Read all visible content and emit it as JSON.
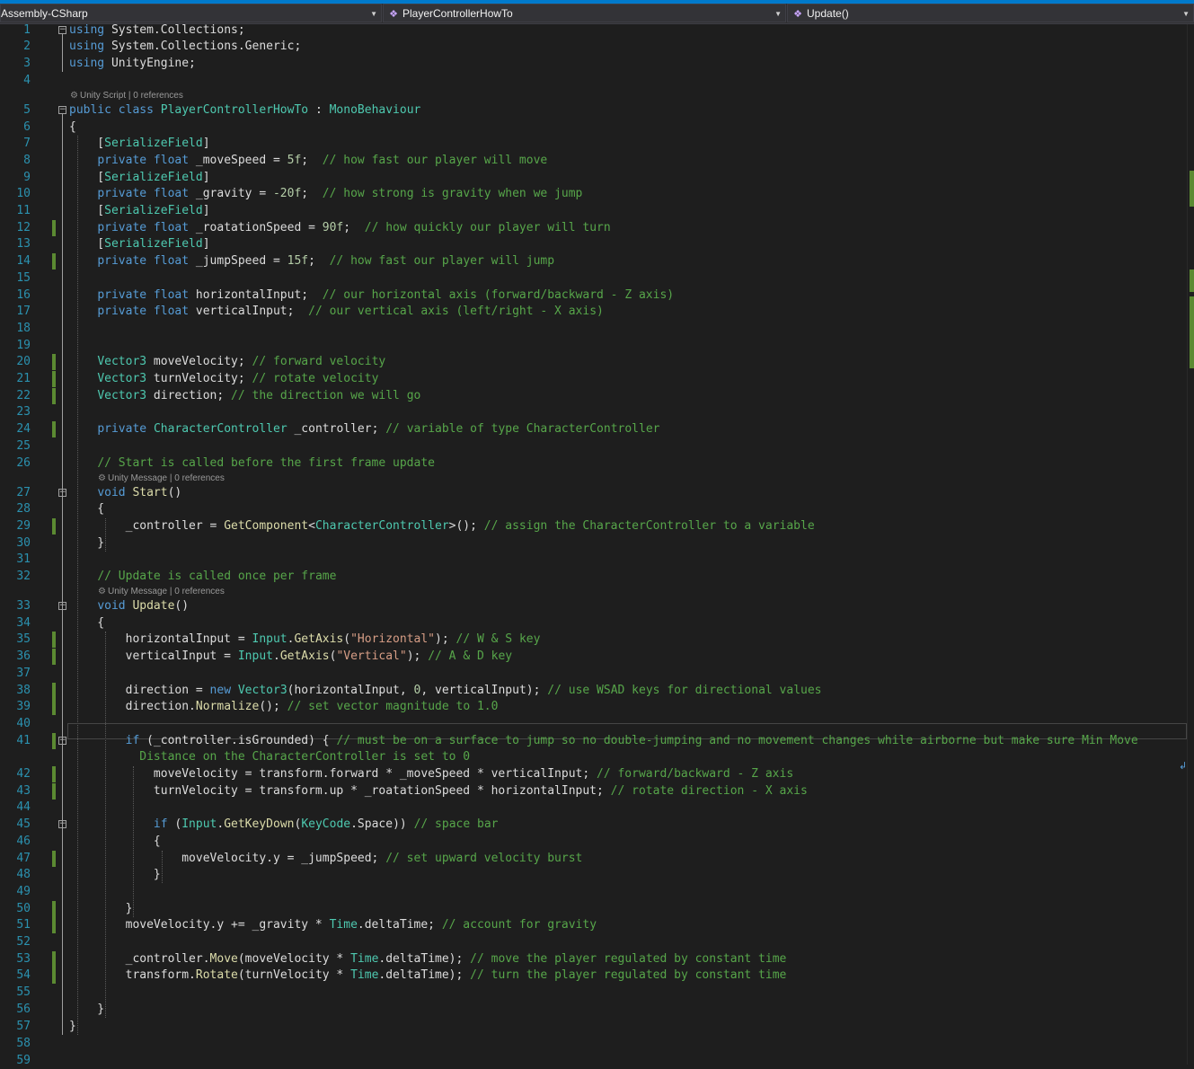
{
  "navbar": {
    "project": "Assembly-CSharp",
    "type": "PlayerControllerHowTo",
    "member": "Update()"
  },
  "codelens": {
    "unity_script": "Unity Script | 0 references",
    "unity_message": "Unity Message | 0 references"
  },
  "line_numbers": [
    "1",
    "2",
    "3",
    "4",
    "5",
    "6",
    "7",
    "8",
    "9",
    "10",
    "11",
    "12",
    "13",
    "14",
    "15",
    "16",
    "17",
    "18",
    "19",
    "20",
    "21",
    "22",
    "23",
    "24",
    "25",
    "26",
    "27",
    "28",
    "29",
    "30",
    "31",
    "32",
    "33",
    "34",
    "35",
    "36",
    "37",
    "38",
    "39",
    "40",
    "41",
    "42",
    "43",
    "44",
    "45",
    "46",
    "47",
    "48",
    "49",
    "50",
    "51",
    "52",
    "53",
    "54",
    "55",
    "56",
    "57",
    "58",
    "59"
  ],
  "code": [
    [
      [
        "k",
        "using "
      ],
      [
        "p",
        "System.Collections;"
      ]
    ],
    [
      [
        "k",
        "using "
      ],
      [
        "p",
        "System.Collections.Generic;"
      ]
    ],
    [
      [
        "k",
        "using "
      ],
      [
        "p",
        "UnityEngine;"
      ]
    ],
    [],
    [
      [
        "k",
        "public class "
      ],
      [
        "t",
        "PlayerControllerHowTo"
      ],
      [
        "p",
        " : "
      ],
      [
        "t",
        "MonoBehaviour"
      ]
    ],
    [
      [
        "p",
        "{"
      ]
    ],
    [
      [
        "p",
        "    ["
      ],
      [
        "t",
        "SerializeField"
      ],
      [
        "p",
        "]"
      ]
    ],
    [
      [
        "p",
        "    "
      ],
      [
        "k",
        "private float "
      ],
      [
        "p",
        "_moveSpeed = "
      ],
      [
        "n",
        "5f"
      ],
      [
        "p",
        ";  "
      ],
      [
        "c",
        "// how fast our player will move"
      ]
    ],
    [
      [
        "p",
        "    ["
      ],
      [
        "t",
        "SerializeField"
      ],
      [
        "p",
        "]"
      ]
    ],
    [
      [
        "p",
        "    "
      ],
      [
        "k",
        "private float "
      ],
      [
        "p",
        "_gravity = "
      ],
      [
        "n",
        "-20f"
      ],
      [
        "p",
        ";  "
      ],
      [
        "c",
        "// how strong is gravity when we jump"
      ]
    ],
    [
      [
        "p",
        "    ["
      ],
      [
        "t",
        "SerializeField"
      ],
      [
        "p",
        "]"
      ]
    ],
    [
      [
        "p",
        "    "
      ],
      [
        "k",
        "private float "
      ],
      [
        "p",
        "_roatationSpeed = "
      ],
      [
        "n",
        "90f"
      ],
      [
        "p",
        ";  "
      ],
      [
        "c",
        "// how quickly our player will turn"
      ]
    ],
    [
      [
        "p",
        "    ["
      ],
      [
        "t",
        "SerializeField"
      ],
      [
        "p",
        "]"
      ]
    ],
    [
      [
        "p",
        "    "
      ],
      [
        "k",
        "private float "
      ],
      [
        "p",
        "_jumpSpeed = "
      ],
      [
        "n",
        "15f"
      ],
      [
        "p",
        ";  "
      ],
      [
        "c",
        "// how fast our player will jump"
      ]
    ],
    [],
    [
      [
        "p",
        "    "
      ],
      [
        "k",
        "private float "
      ],
      [
        "p",
        "horizontalInput;  "
      ],
      [
        "c",
        "// our horizontal axis (forward/backward - Z axis)"
      ]
    ],
    [
      [
        "p",
        "    "
      ],
      [
        "k",
        "private float "
      ],
      [
        "p",
        "verticalInput;  "
      ],
      [
        "c",
        "// our vertical axis (left/right - X axis)"
      ]
    ],
    [],
    [],
    [
      [
        "p",
        "    "
      ],
      [
        "t",
        "Vector3"
      ],
      [
        "p",
        " moveVelocity; "
      ],
      [
        "c",
        "// forward velocity"
      ]
    ],
    [
      [
        "p",
        "    "
      ],
      [
        "t",
        "Vector3"
      ],
      [
        "p",
        " turnVelocity; "
      ],
      [
        "c",
        "// rotate velocity"
      ]
    ],
    [
      [
        "p",
        "    "
      ],
      [
        "t",
        "Vector3"
      ],
      [
        "p",
        " direction; "
      ],
      [
        "c",
        "// the direction we will go"
      ]
    ],
    [],
    [
      [
        "p",
        "    "
      ],
      [
        "k",
        "private "
      ],
      [
        "t",
        "CharacterController"
      ],
      [
        "p",
        " _controller; "
      ],
      [
        "c",
        "// variable of type CharacterController"
      ]
    ],
    [],
    [
      [
        "p",
        "    "
      ],
      [
        "c",
        "// Start is called before the first frame update"
      ]
    ],
    [
      [
        "p",
        "    "
      ],
      [
        "k",
        "void "
      ],
      [
        "m",
        "Start"
      ],
      [
        "p",
        "()"
      ]
    ],
    [
      [
        "p",
        "    {"
      ]
    ],
    [
      [
        "p",
        "        _controller = "
      ],
      [
        "m",
        "GetComponent"
      ],
      [
        "p",
        "<"
      ],
      [
        "t",
        "CharacterController"
      ],
      [
        "p",
        ">(); "
      ],
      [
        "c",
        "// assign the CharacterController to a variable"
      ]
    ],
    [
      [
        "p",
        "    }"
      ]
    ],
    [],
    [
      [
        "p",
        "    "
      ],
      [
        "c",
        "// Update is called once per frame"
      ]
    ],
    [
      [
        "p",
        "    "
      ],
      [
        "k",
        "void "
      ],
      [
        "m",
        "Update"
      ],
      [
        "p",
        "()"
      ]
    ],
    [
      [
        "p",
        "    {"
      ]
    ],
    [
      [
        "p",
        "        horizontalInput = "
      ],
      [
        "t",
        "Input"
      ],
      [
        "p",
        "."
      ],
      [
        "m",
        "GetAxis"
      ],
      [
        "p",
        "("
      ],
      [
        "s",
        "\"Horizontal\""
      ],
      [
        "p",
        "); "
      ],
      [
        "c",
        "// W & S key"
      ]
    ],
    [
      [
        "p",
        "        verticalInput = "
      ],
      [
        "t",
        "Input"
      ],
      [
        "p",
        "."
      ],
      [
        "m",
        "GetAxis"
      ],
      [
        "p",
        "("
      ],
      [
        "s",
        "\"Vertical\""
      ],
      [
        "p",
        "); "
      ],
      [
        "c",
        "// A & D key"
      ]
    ],
    [],
    [
      [
        "p",
        "        direction = "
      ],
      [
        "k",
        "new "
      ],
      [
        "t",
        "Vector3"
      ],
      [
        "p",
        "(horizontalInput, "
      ],
      [
        "n",
        "0"
      ],
      [
        "p",
        ", verticalInput); "
      ],
      [
        "c",
        "// use WSAD keys for directional values"
      ]
    ],
    [
      [
        "p",
        "        direction."
      ],
      [
        "m",
        "Normalize"
      ],
      [
        "p",
        "(); "
      ],
      [
        "c",
        "// set vector magnitude to 1.0"
      ]
    ],
    [],
    [
      [
        "p",
        "        "
      ],
      [
        "k",
        "if "
      ],
      [
        "p",
        "(_controller.isGrounded) { "
      ],
      [
        "c",
        "// must be on a surface to jump so no double-jumping and no movement changes while airborne but make sure Min Move"
      ]
    ],
    [
      [
        "c",
        "          Distance on the CharacterController is set to 0"
      ]
    ],
    [
      [
        "p",
        "            moveVelocity = transform.forward * _moveSpeed * verticalInput; "
      ],
      [
        "c",
        "// forward/backward - Z axis"
      ]
    ],
    [
      [
        "p",
        "            turnVelocity = transform.up * _roatationSpeed * horizontalInput; "
      ],
      [
        "c",
        "// rotate direction - X axis"
      ]
    ],
    [],
    [
      [
        "p",
        "            "
      ],
      [
        "k",
        "if "
      ],
      [
        "p",
        "("
      ],
      [
        "t",
        "Input"
      ],
      [
        "p",
        "."
      ],
      [
        "m",
        "GetKeyDown"
      ],
      [
        "p",
        "("
      ],
      [
        "t",
        "KeyCode"
      ],
      [
        "p",
        ".Space)) "
      ],
      [
        "c",
        "// space bar"
      ]
    ],
    [
      [
        "p",
        "            {"
      ]
    ],
    [
      [
        "p",
        "                moveVelocity.y = _jumpSpeed; "
      ],
      [
        "c",
        "// set upward velocity burst"
      ]
    ],
    [
      [
        "p",
        "            }"
      ]
    ],
    [],
    [
      [
        "p",
        "        }"
      ]
    ],
    [
      [
        "p",
        "        moveVelocity.y += _gravity * "
      ],
      [
        "t",
        "Time"
      ],
      [
        "p",
        ".deltaTime; "
      ],
      [
        "c",
        "// account for gravity"
      ]
    ],
    [],
    [
      [
        "p",
        "        _controller."
      ],
      [
        "m",
        "Move"
      ],
      [
        "p",
        "(moveVelocity * "
      ],
      [
        "t",
        "Time"
      ],
      [
        "p",
        ".deltaTime); "
      ],
      [
        "c",
        "// move the player regulated by constant time"
      ]
    ],
    [
      [
        "p",
        "        transform."
      ],
      [
        "m",
        "Rotate"
      ],
      [
        "p",
        "(turnVelocity * "
      ],
      [
        "t",
        "Time"
      ],
      [
        "p",
        ".deltaTime); "
      ],
      [
        "c",
        "// turn the player regulated by constant time"
      ]
    ],
    [],
    [
      [
        "p",
        "    }"
      ]
    ],
    [
      [
        "p",
        "}"
      ]
    ],
    []
  ]
}
